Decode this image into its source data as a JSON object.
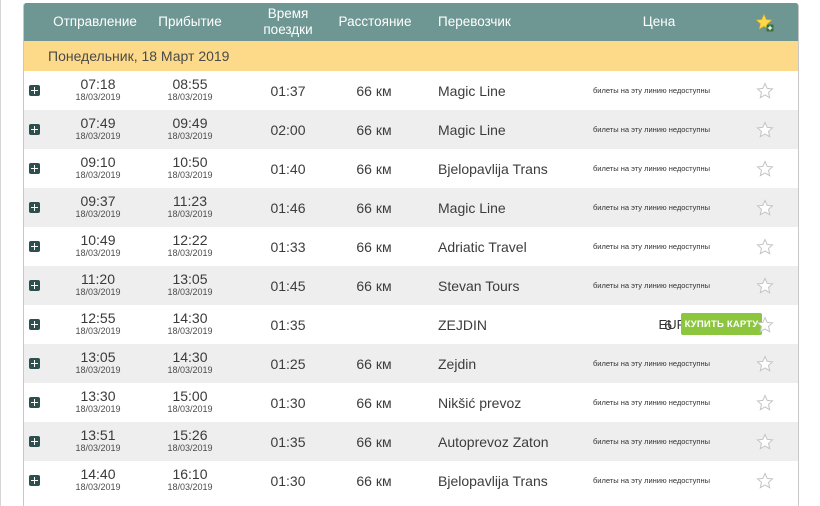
{
  "header": {
    "departure": "Отправление",
    "arrival": "Прибытие",
    "travel_time_line1": "Время",
    "travel_time_line2": "поездки",
    "distance": "Расстояние",
    "carrier": "Перевозчик",
    "price": "Цена",
    "favorites_icon": "star-add-icon"
  },
  "day_label": "Понедельник, 18 Март 2019",
  "unavailable_text": "билеты на эту линию недоступны",
  "buy_label": "КУПИТЬ КАРТУ",
  "colors": {
    "header_bg": "#6e9793",
    "day_bg": "#fdd98a",
    "buy_button": "#8cc63f",
    "expand_icon": "#2d4f4d"
  },
  "rows": [
    {
      "dep": "07:18",
      "dep_date": "18/03/2019",
      "arr": "08:55",
      "arr_date": "18/03/2019",
      "duration": "01:37",
      "distance": "66 км",
      "carrier": "Magic Line",
      "available": false
    },
    {
      "dep": "07:49",
      "dep_date": "18/03/2019",
      "arr": "09:49",
      "arr_date": "18/03/2019",
      "duration": "02:00",
      "distance": "66 км",
      "carrier": "Magic Line",
      "available": false
    },
    {
      "dep": "09:10",
      "dep_date": "18/03/2019",
      "arr": "10:50",
      "arr_date": "18/03/2019",
      "duration": "01:40",
      "distance": "66 км",
      "carrier": "Bjelopavlija Trans",
      "available": false
    },
    {
      "dep": "09:37",
      "dep_date": "18/03/2019",
      "arr": "11:23",
      "arr_date": "18/03/2019",
      "duration": "01:46",
      "distance": "66 км",
      "carrier": "Magic Line",
      "available": false
    },
    {
      "dep": "10:49",
      "dep_date": "18/03/2019",
      "arr": "12:22",
      "arr_date": "18/03/2019",
      "duration": "01:33",
      "distance": "66 км",
      "carrier": "Adriatic Travel",
      "available": false
    },
    {
      "dep": "11:20",
      "dep_date": "18/03/2019",
      "arr": "13:05",
      "arr_date": "18/03/2019",
      "duration": "01:45",
      "distance": "66 км",
      "carrier": "Stevan Tours",
      "available": false
    },
    {
      "dep": "12:55",
      "dep_date": "18/03/2019",
      "arr": "14:30",
      "arr_date": "18/03/2019",
      "duration": "01:35",
      "distance": "",
      "carrier": "ZEJDIN",
      "available": true,
      "price": "6",
      "currency": "EUR"
    },
    {
      "dep": "13:05",
      "dep_date": "18/03/2019",
      "arr": "14:30",
      "arr_date": "18/03/2019",
      "duration": "01:25",
      "distance": "66 км",
      "carrier": "Zejdin",
      "available": false
    },
    {
      "dep": "13:30",
      "dep_date": "18/03/2019",
      "arr": "15:00",
      "arr_date": "18/03/2019",
      "duration": "01:30",
      "distance": "66 км",
      "carrier": "Nikšić prevoz",
      "available": false
    },
    {
      "dep": "13:51",
      "dep_date": "18/03/2019",
      "arr": "15:26",
      "arr_date": "18/03/2019",
      "duration": "01:35",
      "distance": "66 км",
      "carrier": "Autoprevoz Zaton",
      "available": false
    },
    {
      "dep": "14:40",
      "dep_date": "18/03/2019",
      "arr": "16:10",
      "arr_date": "18/03/2019",
      "duration": "01:30",
      "distance": "66 км",
      "carrier": "Bjelopavlija Trans",
      "available": false
    }
  ]
}
